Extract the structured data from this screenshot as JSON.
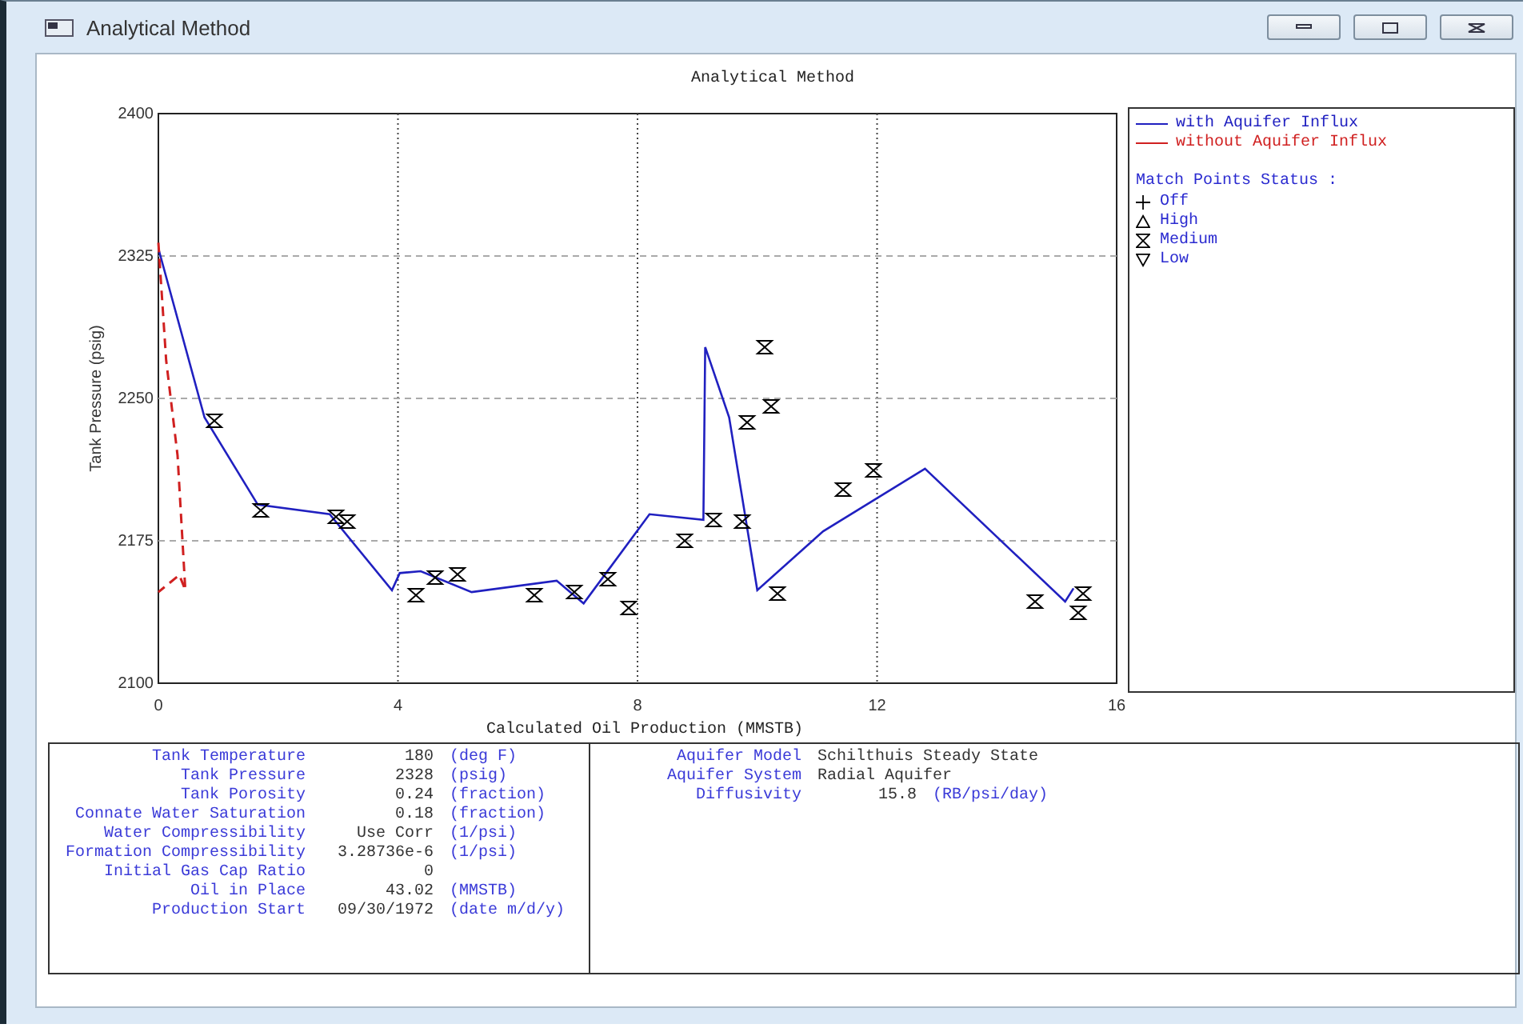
{
  "window": {
    "title": "Analytical Method"
  },
  "chart": {
    "chart_data": {
      "type": "line",
      "title": "Analytical Method",
      "xlabel": "Calculated Oil Production (MMSTB)",
      "ylabel": "Tank Pressure (psig)",
      "xlim": [
        0,
        16
      ],
      "ylim": [
        2100,
        2400
      ],
      "xticks": [
        0,
        4,
        8,
        12,
        16
      ],
      "yticks": [
        2100,
        2175,
        2250,
        2325,
        2400
      ],
      "grid": true,
      "series": [
        {
          "name": "with Aquifer Influx",
          "color": "#2020c0",
          "line_style": "solid",
          "x": [
            0,
            0.77,
            1.66,
            2.86,
            3.9,
            4.03,
            4.38,
            5.23,
            6.65,
            7.1,
            8.2,
            9.1,
            9.13,
            9.53,
            10.0,
            11.1,
            12.8,
            15.14,
            15.28
          ],
          "values": [
            2329,
            2240,
            2194,
            2189,
            2149,
            2158,
            2159,
            2148,
            2154,
            2142,
            2189,
            2186,
            2277,
            2240,
            2149,
            2180,
            2213,
            2143,
            2150
          ]
        },
        {
          "name": "without Aquifer Influx",
          "color": "#d02020",
          "line_style": "dashed",
          "x": [
            0,
            0.13,
            0.32,
            0.45,
            0.35,
            0
          ],
          "values": [
            2332,
            2270,
            2220,
            2149,
            2157,
            2148
          ]
        },
        {
          "name": "Medium",
          "color": "#000000",
          "type": "scatter",
          "x": [
            0.93,
            1.71,
            2.96,
            3.15,
            4.3,
            4.62,
            4.99,
            6.27,
            6.94,
            7.5,
            7.84,
            8.79,
            9.27,
            9.74,
            9.83,
            10.12,
            10.23,
            10.35,
            11.44,
            11.95,
            14.64,
            15.36,
            15.44
          ],
          "values": [
            2238,
            2191,
            2188,
            2185,
            2146,
            2156,
            2157,
            2146,
            2148,
            2155,
            2140,
            2175,
            2186,
            2185,
            2237,
            2277,
            2246,
            2147,
            2202,
            2212,
            2143,
            2137,
            2147
          ]
        }
      ]
    }
  },
  "legend": {
    "status_title": "Match Points Status :",
    "statuses": [
      {
        "label": "Off",
        "kind": "plus"
      },
      {
        "label": "High",
        "kind": "triangle-up"
      },
      {
        "kind": "hourglass"
      },
      {
        "label": "Low",
        "kind": "triangle-down"
      }
    ]
  },
  "tank_parameters": [
    {
      "label": "Tank Temperature",
      "value": "180",
      "unit": "(deg F)"
    },
    {
      "label": "Tank Pressure",
      "value": "2328",
      "unit": "(psig)"
    },
    {
      "label": "Tank Porosity",
      "value": "0.24",
      "unit": "(fraction)"
    },
    {
      "label": "Connate Water Saturation",
      "value": "0.18",
      "unit": "(fraction)"
    },
    {
      "label": "Water Compressibility",
      "value": "Use Corr",
      "unit": "(1/psi)"
    },
    {
      "label": "Formation Compressibility",
      "value": "3.28736e-6",
      "unit": "(1/psi)"
    },
    {
      "label": "Initial Gas Cap Ratio",
      "value": "0"
    },
    {
      "label": "Oil in Place",
      "value": "43.02",
      "unit": "(MMSTB)"
    },
    {
      "label": "Production Start",
      "value": "09/30/1972",
      "unit": "(date m/d/y)"
    }
  ],
  "aquifer_parameters": [
    {
      "label": "Aquifer Model",
      "value": "Schilthuis Steady State",
      "kind": "text"
    },
    {
      "label": "Aquifer System",
      "value": "Radial Aquifer",
      "kind": "text"
    },
    {
      "label": "Diffusivity",
      "value": "15.8",
      "unit": "(RB/psi/day)",
      "kind": "quantity"
    }
  ]
}
